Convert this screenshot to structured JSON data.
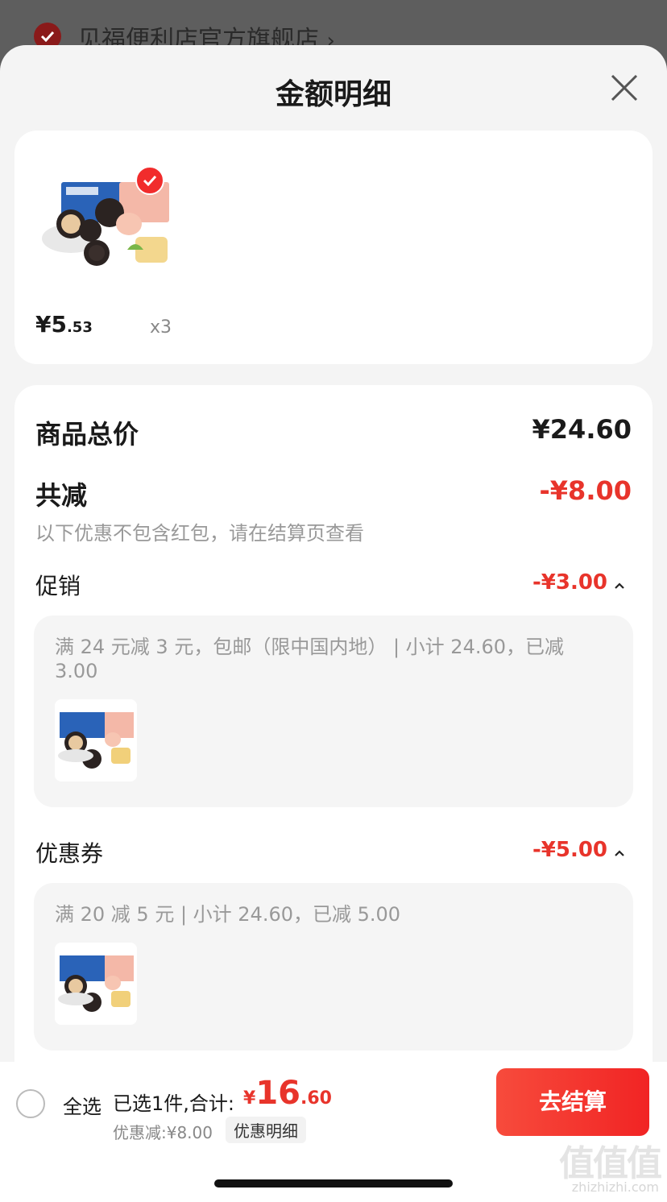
{
  "background_page": {
    "store_name": "见福便利店官方旗舰店",
    "chevron": "›"
  },
  "sheet": {
    "title": "金额明细",
    "close_icon": "close-x-icon"
  },
  "product": {
    "price_main": "¥5",
    "price_decimal": ".53",
    "quantity": "x3",
    "selected": true
  },
  "summary": {
    "total_label": "商品总价",
    "total_value": "¥24.60",
    "reduce_label": "共减",
    "reduce_value": "-¥8.00",
    "note": "以下优惠不包含红包，请在结算页查看"
  },
  "promotion": {
    "label": "促销",
    "value": "-¥3.00",
    "detail": "满 24 元减 3 元，包邮（限中国内地） | 小计 24.60，已减 3.00"
  },
  "coupon": {
    "label": "优惠券",
    "value": "-¥5.00",
    "detail": "满 20 减 5 元 | 小计 24.60，已减 5.00"
  },
  "bottom_bar": {
    "select_all": "全选",
    "selected_text": "已选1件,合计:",
    "currency": "¥",
    "amount_main": "16",
    "amount_decimal": ".60",
    "discount": "优惠减:¥8.00",
    "detail_link": "优惠明细",
    "checkout": "去结算"
  },
  "watermark": {
    "glyphs": "值值值",
    "url": "zhizhizhi.com"
  },
  "colors": {
    "accent_red": "#e8342b",
    "button_red": "#f12424"
  }
}
